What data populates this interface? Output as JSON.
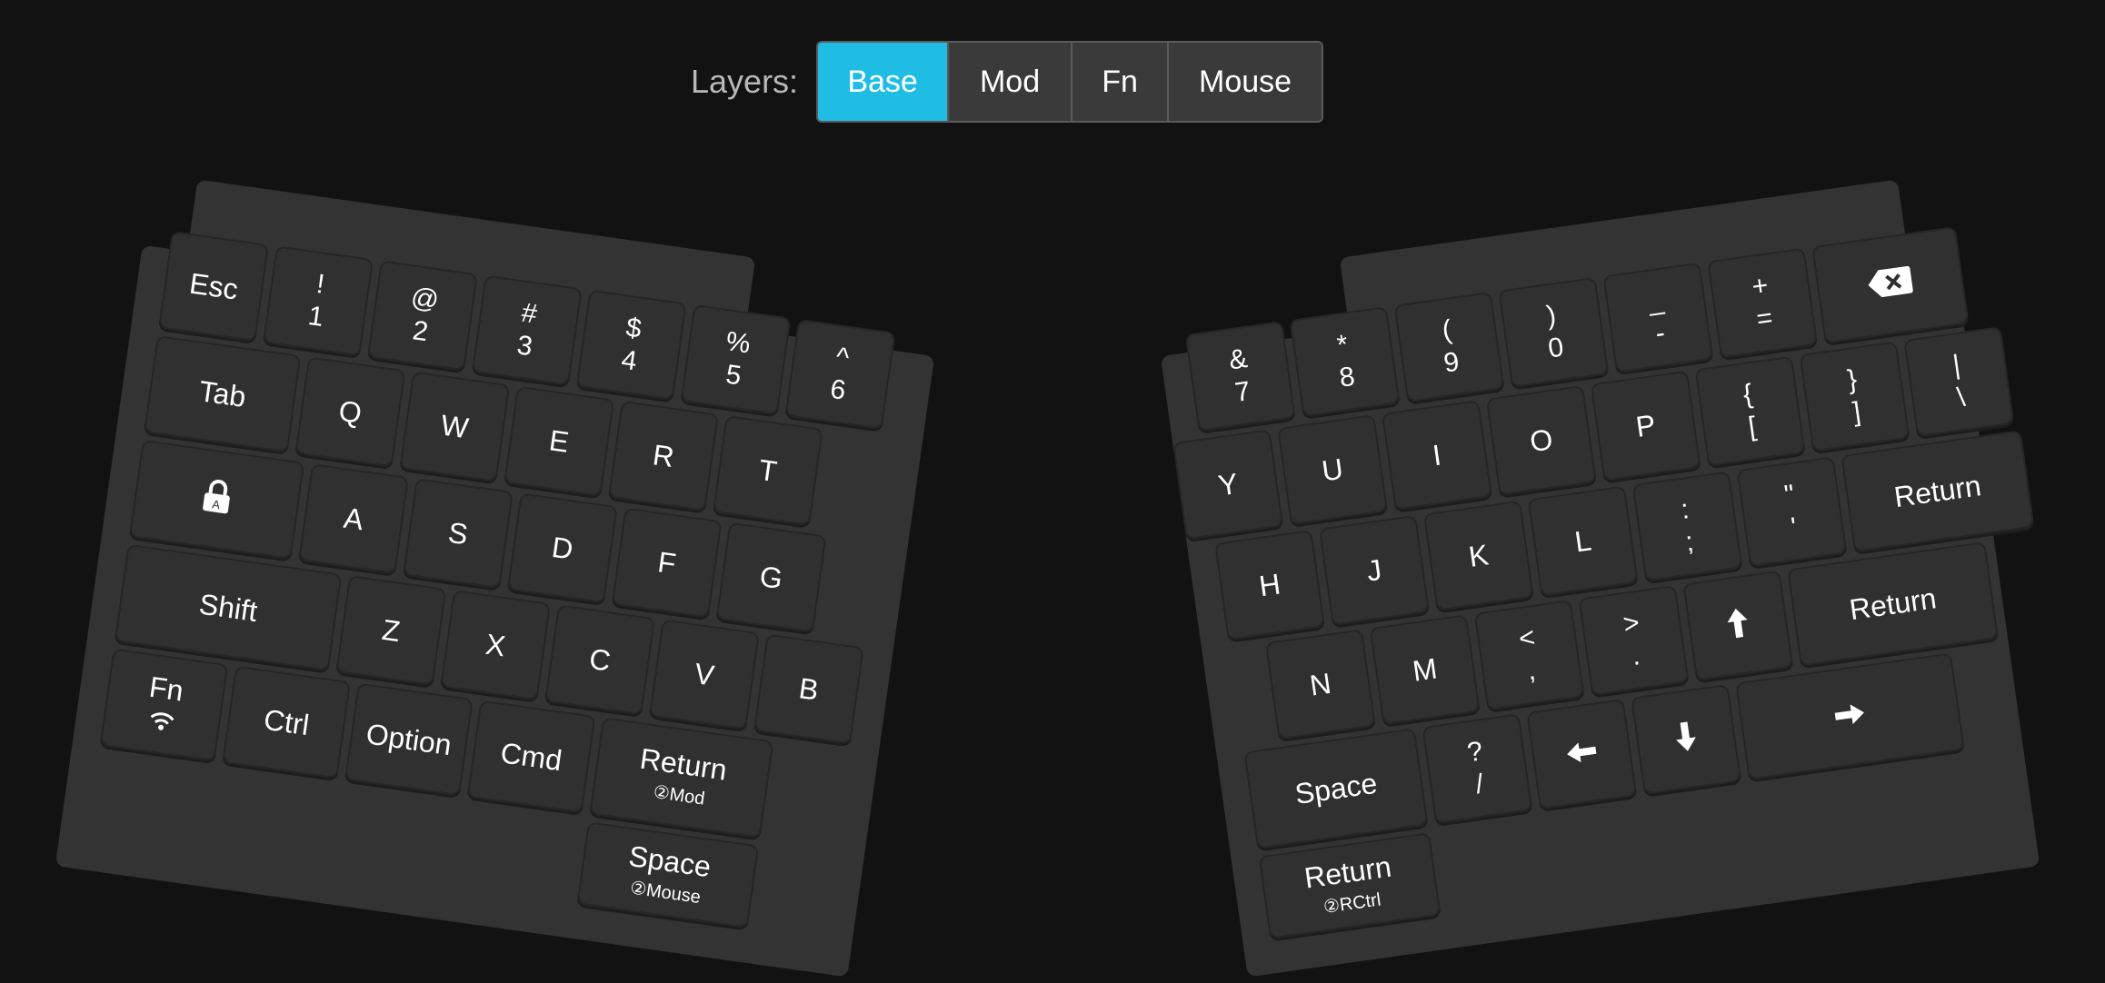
{
  "toolbar": {
    "label": "Layers:",
    "tabs": [
      {
        "label": "Base",
        "active": true
      },
      {
        "label": "Mod",
        "active": false
      },
      {
        "label": "Fn",
        "active": false
      },
      {
        "label": "Mouse",
        "active": false
      }
    ]
  },
  "colors": {
    "background": "#121212",
    "case": "#333333",
    "key": "#303030",
    "active_tab": "#1fbde3"
  },
  "left": {
    "row0": [
      {
        "main": "Esc"
      },
      {
        "top": "!",
        "bottom": "1"
      },
      {
        "top": "@",
        "bottom": "2"
      },
      {
        "top": "#",
        "bottom": "3"
      },
      {
        "top": "$",
        "bottom": "4"
      },
      {
        "top": "%",
        "bottom": "5"
      },
      {
        "top": "^",
        "bottom": "6"
      }
    ],
    "row1": [
      {
        "main": "Tab"
      },
      {
        "main": "Q"
      },
      {
        "main": "W"
      },
      {
        "main": "E"
      },
      {
        "main": "R"
      },
      {
        "main": "T"
      }
    ],
    "row2": [
      {
        "icon": "caps-lock-icon"
      },
      {
        "main": "A"
      },
      {
        "main": "S"
      },
      {
        "main": "D"
      },
      {
        "main": "F"
      },
      {
        "main": "G"
      }
    ],
    "row3": [
      {
        "main": "Shift"
      },
      {
        "main": "Z"
      },
      {
        "main": "X"
      },
      {
        "main": "C"
      },
      {
        "main": "V"
      },
      {
        "main": "B"
      }
    ],
    "row4": [
      {
        "main": "Fn",
        "icon": "wireless-icon"
      },
      {
        "main": "Ctrl"
      },
      {
        "main": "Option"
      },
      {
        "main": "Cmd"
      },
      {
        "main": "Return",
        "sub": "②Mod"
      }
    ],
    "row5": [
      {
        "main": "Space",
        "sub": "②Mouse"
      }
    ]
  },
  "right": {
    "row0": [
      {
        "top": "_",
        "bottom": "-"
      },
      {
        "top": "+",
        "bottom": "="
      },
      {
        "icon": "backspace-icon"
      }
    ],
    "row0b": [
      {
        "top": "&",
        "bottom": "7"
      },
      {
        "top": "*",
        "bottom": "8"
      },
      {
        "top": "(",
        "bottom": "9"
      },
      {
        "top": ")",
        "bottom": "0"
      }
    ],
    "row1": [
      {
        "main": "Y"
      },
      {
        "main": "U"
      },
      {
        "main": "I"
      },
      {
        "main": "O"
      },
      {
        "main": "P"
      },
      {
        "top": "{",
        "bottom": "["
      },
      {
        "top": "}",
        "bottom": "]"
      },
      {
        "top": "|",
        "bottom": "\\"
      }
    ],
    "row2": [
      {
        "main": "H"
      },
      {
        "main": "J"
      },
      {
        "main": "K"
      },
      {
        "main": "L"
      },
      {
        "top": ":",
        "bottom": ";"
      },
      {
        "top": "\"",
        "bottom": "'"
      },
      {
        "main": "Return"
      }
    ],
    "row3": [
      {
        "main": "N"
      },
      {
        "main": "M"
      },
      {
        "top": "<",
        "bottom": ","
      },
      {
        "top": ">",
        "bottom": "."
      },
      {
        "icon": "arrow-up-icon"
      },
      {
        "main": "Return"
      }
    ],
    "row4": [
      {
        "main": "Space"
      },
      {
        "top": "?",
        "bottom": "/"
      },
      {
        "icon": "arrow-left-icon"
      },
      {
        "icon": "arrow-down-icon"
      },
      {
        "icon": "arrow-right-icon"
      }
    ],
    "row5": [
      {
        "main": "Return",
        "sub": "②RCtrl"
      }
    ]
  }
}
